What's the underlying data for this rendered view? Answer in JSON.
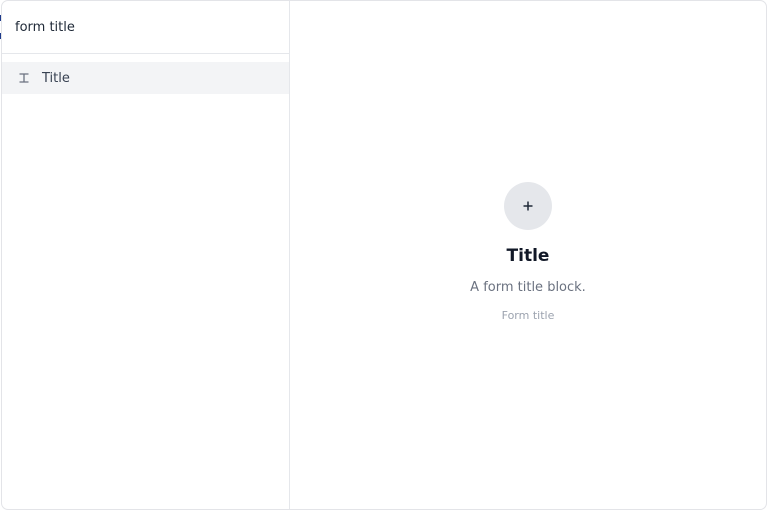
{
  "search": {
    "value": "form title",
    "placeholder": ""
  },
  "results": [
    {
      "label": "Title",
      "icon": "text-heading-icon"
    }
  ],
  "preview": {
    "icon": "plus-icon",
    "title": "Title",
    "description": "A form title block.",
    "sample": "Form title"
  },
  "colors": {
    "selected_row_bg": "#f3f4f6",
    "icon_circle_bg": "#e5e7eb",
    "title_text": "#111827",
    "muted_text": "#6b7280"
  }
}
